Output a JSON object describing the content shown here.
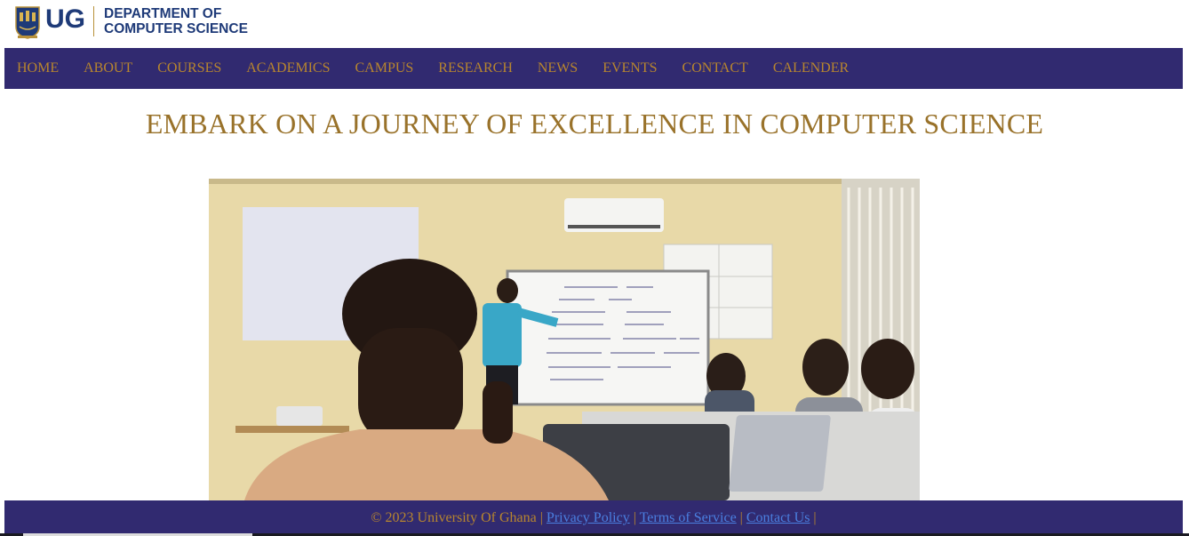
{
  "header": {
    "logo_mark": "UG",
    "dept_line1": "DEPARTMENT OF",
    "dept_line2": "COMPUTER SCIENCE"
  },
  "nav": {
    "items": [
      "HOME",
      "ABOUT",
      "COURSES",
      "ACADEMICS",
      "CAMPUS",
      "RESEARCH",
      "NEWS",
      "EVENTS",
      "CONTACT",
      "CALENDER"
    ]
  },
  "hero": {
    "headline": "EMBARK ON A JOURNEY OF EXCELLENCE IN COMPUTER SCIENCE"
  },
  "footer": {
    "copyright": "© 2023 University Of Ghana",
    "sep": "|",
    "links": [
      "Privacy Policy",
      "Terms of Service",
      "Contact Us"
    ]
  },
  "colors": {
    "nav_bg": "#312a70",
    "nav_text": "#b8862e",
    "headline": "#99722a",
    "brand_blue": "#1e3a78",
    "link": "#4a7fe0"
  }
}
